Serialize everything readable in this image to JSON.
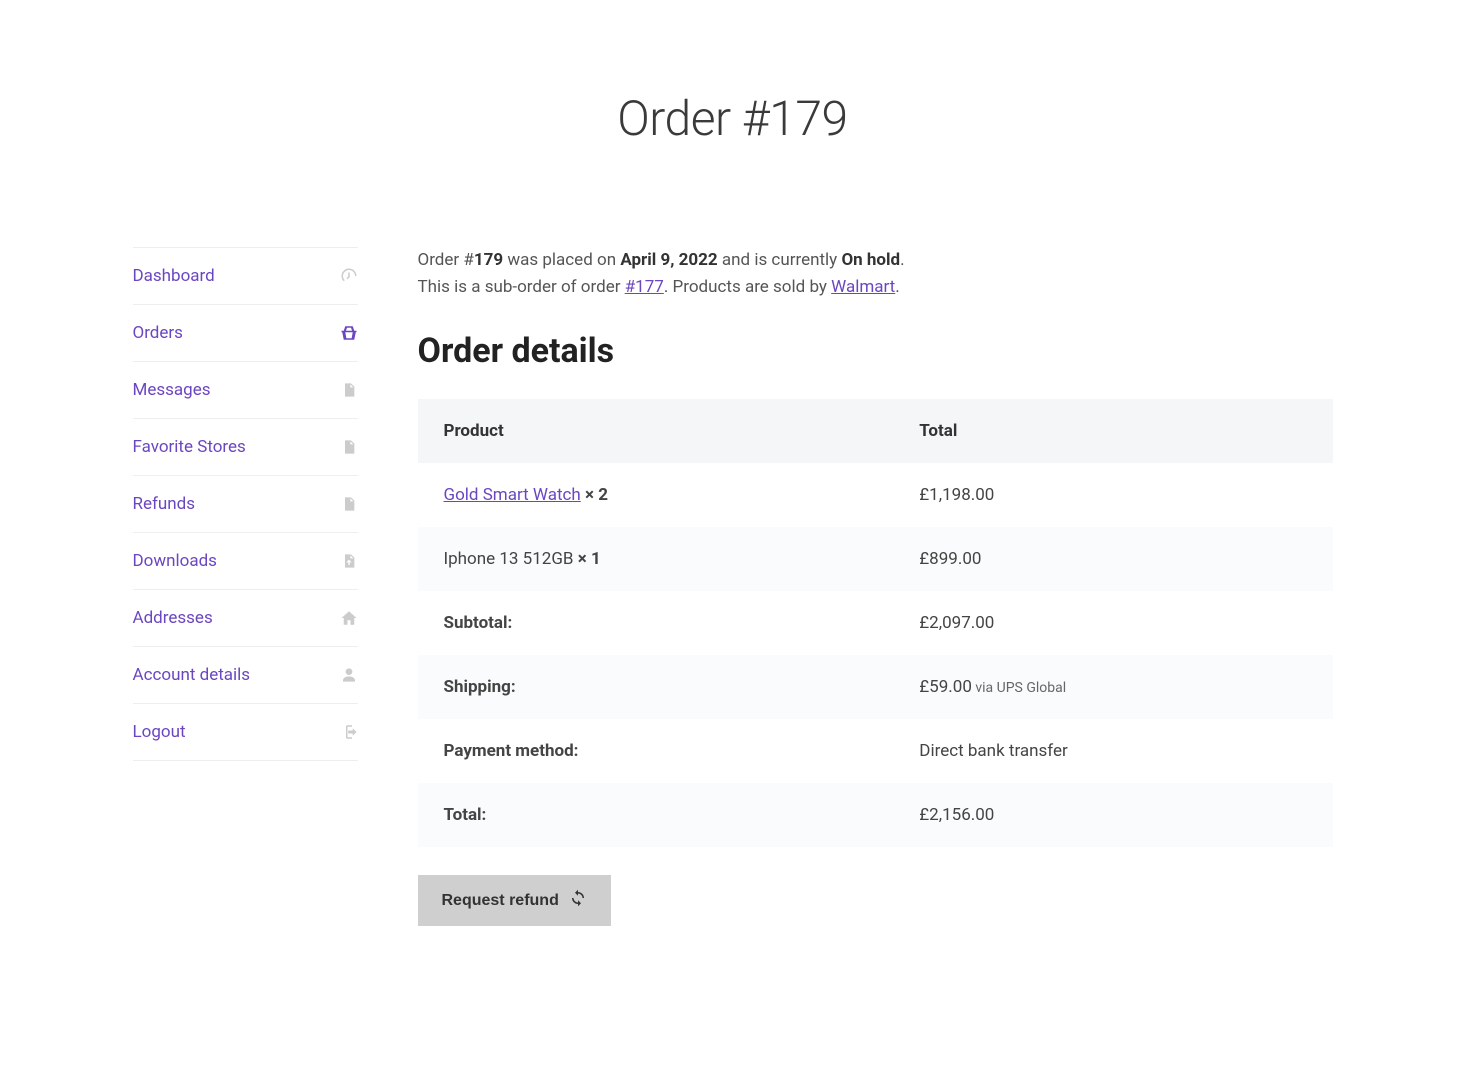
{
  "page": {
    "title": "Order #179"
  },
  "sidebar": {
    "items": [
      {
        "label": "Dashboard"
      },
      {
        "label": "Orders"
      },
      {
        "label": "Messages"
      },
      {
        "label": "Favorite Stores"
      },
      {
        "label": "Refunds"
      },
      {
        "label": "Downloads"
      },
      {
        "label": "Addresses"
      },
      {
        "label": "Account details"
      },
      {
        "label": "Logout"
      }
    ]
  },
  "order_info": {
    "prefix": "Order #",
    "order_number": "179",
    "placed_text": " was placed on ",
    "date": "April 9, 2022",
    "status_text": " and is currently ",
    "status": "On hold",
    "period": ".",
    "suborder_prefix": "This is a sub-order of order ",
    "parent_order": "#177",
    "sold_by_prefix": ". Products are sold by ",
    "vendor": "Walmart",
    "suborder_period": "."
  },
  "details": {
    "heading": "Order details",
    "columns": {
      "product": "Product",
      "total": "Total"
    },
    "items": [
      {
        "name": "Gold Smart Watch",
        "qty_text": " × 2",
        "linked": true,
        "total": "£1,198.00"
      },
      {
        "name": "Iphone 13 512GB",
        "qty_text": " × 1",
        "linked": false,
        "total": "£899.00"
      }
    ],
    "rows": [
      {
        "label": "Subtotal:",
        "value": "£2,097.00",
        "via": ""
      },
      {
        "label": "Shipping:",
        "value": "£59.00",
        "via": " via UPS Global"
      },
      {
        "label": "Payment method:",
        "value": "Direct bank transfer",
        "via": ""
      },
      {
        "label": "Total:",
        "value": "£2,156.00",
        "via": ""
      }
    ]
  },
  "actions": {
    "refund_label": "Request refund"
  }
}
